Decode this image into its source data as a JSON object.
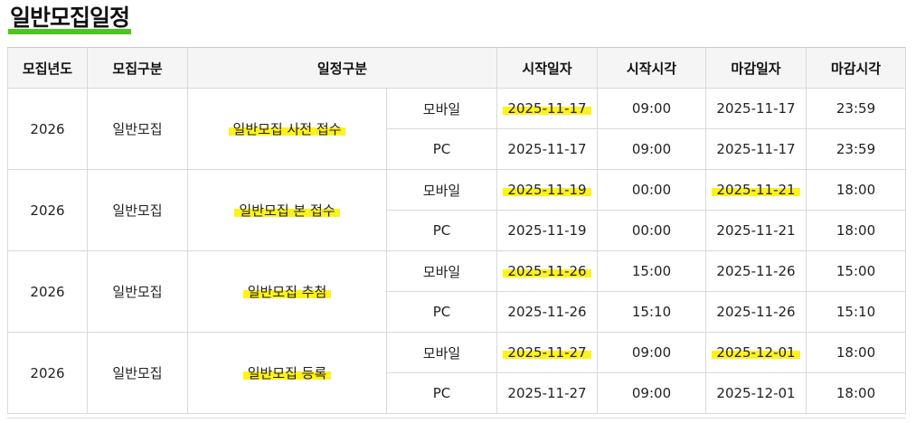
{
  "title": "일반모집일정",
  "headers": {
    "year": "모집년도",
    "category": "모집구분",
    "stage": "일정구분",
    "start_date": "시작일자",
    "start_time": "시작시각",
    "end_date": "마감일자",
    "end_time": "마감시각"
  },
  "groups": [
    {
      "year": "2026",
      "category": "일반모집",
      "stage": "일반모집 사전 접수",
      "rows": [
        {
          "channel": "모바일",
          "start_date": "2025-11-17",
          "start_time": "09:00",
          "end_date": "2025-11-17",
          "end_time": "23:59"
        },
        {
          "channel": "PC",
          "start_date": "2025-11-17",
          "start_time": "09:00",
          "end_date": "2025-11-17",
          "end_time": "23:59"
        }
      ]
    },
    {
      "year": "2026",
      "category": "일반모집",
      "stage": "일반모집 본 접수",
      "rows": [
        {
          "channel": "모바일",
          "start_date": "2025-11-19",
          "start_time": "00:00",
          "end_date": "2025-11-21",
          "end_time": "18:00"
        },
        {
          "channel": "PC",
          "start_date": "2025-11-19",
          "start_time": "00:00",
          "end_date": "2025-11-21",
          "end_time": "18:00"
        }
      ]
    },
    {
      "year": "2026",
      "category": "일반모집",
      "stage": "일반모집 추첨",
      "rows": [
        {
          "channel": "모바일",
          "start_date": "2025-11-26",
          "start_time": "15:00",
          "end_date": "2025-11-26",
          "end_time": "15:00"
        },
        {
          "channel": "PC",
          "start_date": "2025-11-26",
          "start_time": "15:10",
          "end_date": "2025-11-26",
          "end_time": "15:10"
        }
      ]
    },
    {
      "year": "2026",
      "category": "일반모집",
      "stage": "일반모집 등록",
      "rows": [
        {
          "channel": "모바일",
          "start_date": "2025-11-27",
          "start_time": "09:00",
          "end_date": "2025-12-01",
          "end_time": "18:00"
        },
        {
          "channel": "PC",
          "start_date": "2025-11-27",
          "start_time": "09:00",
          "end_date": "2025-12-01",
          "end_time": "18:00"
        }
      ]
    }
  ],
  "colors": {
    "highlight": "#fff21a",
    "title_underline": "#4cc61c"
  }
}
